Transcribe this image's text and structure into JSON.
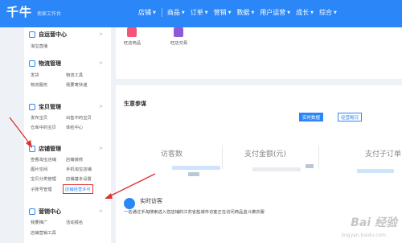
{
  "header": {
    "logo": "千牛",
    "subtitle": "卖家工作台",
    "nav": [
      {
        "label": "店铺"
      },
      {
        "label": "商品"
      },
      {
        "label": "订单"
      },
      {
        "label": "营销"
      },
      {
        "label": "数据"
      },
      {
        "label": "用户运营"
      },
      {
        "label": "成长"
      },
      {
        "label": "综合"
      }
    ]
  },
  "sidebar": {
    "sections": [
      {
        "title": "自运营中心",
        "icon": "self-operation-icon",
        "links": [
          "淘宝直播"
        ]
      },
      {
        "title": "物流管理",
        "icon": "truck-icon",
        "links": [
          "发货",
          "物流工具",
          "物流服务",
          "我要寄快递"
        ]
      },
      {
        "title": "宝贝管理",
        "icon": "box-icon",
        "links": [
          "发布宝贝",
          "出售中的宝贝",
          "仓库中的宝贝",
          "体检中心"
        ]
      },
      {
        "title": "店铺管理",
        "icon": "store-icon",
        "links": [
          "查看淘宝店铺",
          "店铺装修",
          "图片空间",
          "手机淘宝店铺",
          "宝贝分类管理",
          "店铺基本设置",
          "子账号管理",
          "店铺经营许可"
        ]
      },
      {
        "title": "营销中心",
        "icon": "marketing-icon",
        "links": [
          "我要推广",
          "活动报名",
          "店铺营销工具"
        ]
      }
    ]
  },
  "apps": [
    {
      "label": "旺店商品",
      "color": "#f2547a"
    },
    {
      "label": "旺店交易",
      "color": "#8e5bd8"
    }
  ],
  "main": {
    "title": "生意参谋",
    "tabs": [
      "实时数据",
      "经营概况"
    ],
    "metrics": [
      "访客数",
      "支付金额(元)",
      "支付子订单"
    ],
    "notice_title": "实时访客",
    "notice_text": "一名通过手淘搜索进入您店铺的江苏省盐城市访客正在访问商品监斗袭衣服"
  },
  "watermark": {
    "text": "Bai 经验",
    "sub": "jingyan.baidu.com"
  },
  "colors": {
    "brand": "#2b87f7",
    "annotation": "#e03030"
  }
}
